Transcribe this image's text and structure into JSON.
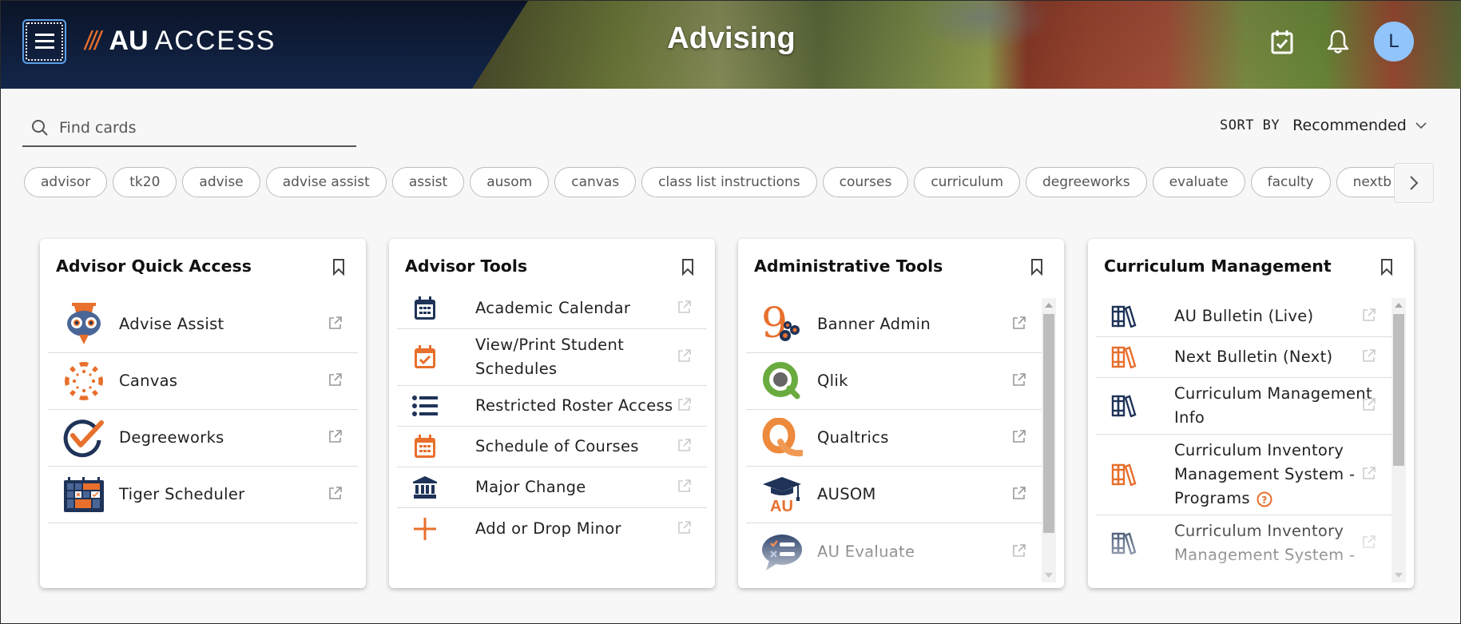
{
  "header": {
    "menu_label": "Menu",
    "logo_slashes": "///",
    "logo_au": "AU",
    "logo_access": "ACCESS",
    "title": "Advising",
    "avatar_initial": "L",
    "icons": [
      "calendar-check-icon",
      "bell-icon"
    ]
  },
  "search": {
    "placeholder": "Find cards",
    "value": ""
  },
  "sort": {
    "label": "SORT BY",
    "value": "Recommended"
  },
  "tags": [
    "advisor",
    "tk20",
    "advise",
    "advise assist",
    "assist",
    "ausom",
    "canvas",
    "class list instructions",
    "courses",
    "curriculum",
    "degreeworks",
    "evaluate",
    "faculty",
    "nextb"
  ],
  "colors": {
    "navy": "#1f3358",
    "orange": "#e86f2c",
    "avatar": "#90c4fb"
  },
  "cards": [
    {
      "title": "Advisor Quick Access",
      "items": [
        {
          "label": "Advise Assist",
          "icon": "owl-icon"
        },
        {
          "label": "Canvas",
          "icon": "canvas-icon"
        },
        {
          "label": "Degreeworks",
          "icon": "degreeworks-check-icon"
        },
        {
          "label": "Tiger Scheduler",
          "icon": "scheduler-calendar-icon"
        }
      ]
    },
    {
      "title": "Advisor Tools",
      "items": [
        {
          "label": "Academic Calendar",
          "icon": "calendar-icon"
        },
        {
          "label": "View/Print Student Schedules",
          "icon": "calendar-check-icon"
        },
        {
          "label": "Restricted Roster Access",
          "icon": "list-icon"
        },
        {
          "label": "Schedule of Courses",
          "icon": "calendar-icon"
        },
        {
          "label": "Major Change",
          "icon": "institution-icon"
        },
        {
          "label": "Add or Drop Minor",
          "icon": "plus-icon"
        }
      ]
    },
    {
      "title": "Administrative Tools",
      "items": [
        {
          "label": "Banner Admin",
          "icon": "banner-icon"
        },
        {
          "label": "Qlik",
          "icon": "qlik-icon"
        },
        {
          "label": "Qualtrics",
          "icon": "qualtrics-icon"
        },
        {
          "label": "AUSOM",
          "icon": "ausom-icon"
        },
        {
          "label": "AU Evaluate",
          "icon": "evaluate-icon"
        }
      ]
    },
    {
      "title": "Curriculum Management",
      "items": [
        {
          "label": "AU Bulletin (Live)",
          "icon": "books-icon"
        },
        {
          "label": "Next Bulletin (Next)",
          "icon": "books-icon"
        },
        {
          "label": "Curriculum Management Info",
          "icon": "books-icon"
        },
        {
          "label": "Curriculum Inventory Management System - Programs",
          "icon": "books-icon",
          "help": true
        },
        {
          "label": "Curriculum Inventory Management System -",
          "icon": "books-icon"
        }
      ]
    }
  ]
}
